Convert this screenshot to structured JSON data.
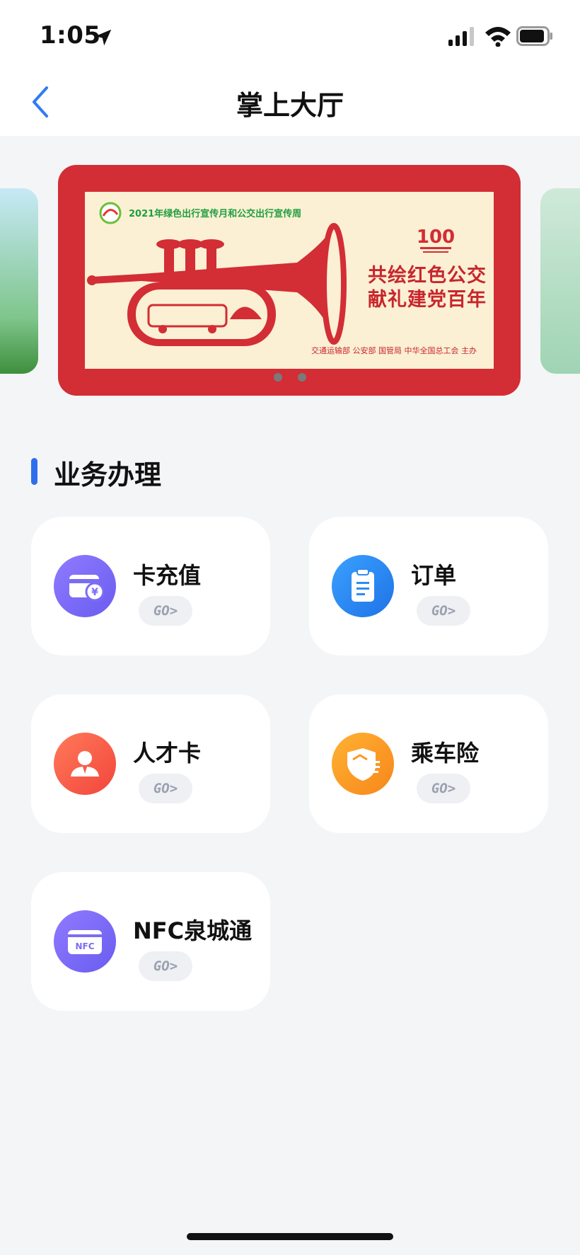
{
  "status": {
    "time": "1:05"
  },
  "header": {
    "title": "掌上大厅"
  },
  "banner": {
    "top_text": "2021年绿色出行宣传月和公交出行宣传周",
    "slogan_line1": "共绘红色公交",
    "slogan_line2": "献礼建党百年",
    "hosts": "交通运输部  公安部  国管局  中华全国总工会  主办",
    "page_count": 2
  },
  "section": {
    "title": "业务办理"
  },
  "cards": [
    {
      "label": "卡充值",
      "go": "GO>",
      "icon": "wallet-yen-icon",
      "color": "#7b6cf6"
    },
    {
      "label": "订单",
      "go": "GO>",
      "icon": "clipboard-icon",
      "color": "#2b8cf5"
    },
    {
      "label": "人才卡",
      "go": "GO>",
      "icon": "person-icon",
      "color": "#f55b45"
    },
    {
      "label": "乘车险",
      "go": "GO>",
      "icon": "shield-icon",
      "color": "#f99a26"
    },
    {
      "label": "NFC泉城通",
      "go": "GO>",
      "icon": "nfc-card-icon",
      "icon_text": "NFC",
      "color": "#7b6cf6"
    }
  ]
}
